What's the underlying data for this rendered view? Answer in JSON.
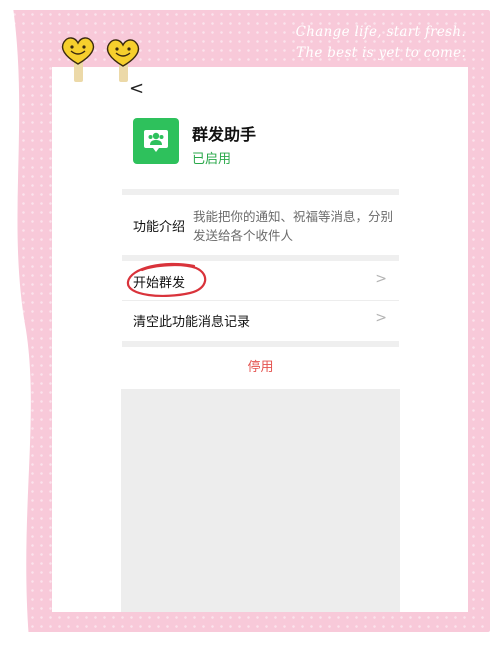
{
  "decor": {
    "tagline_line1": "Change life, start fresh.",
    "tagline_line2": "The best is yet to come.",
    "frame_color": "#f8c9d9",
    "accent_circle_color": "#d9333b"
  },
  "header": {
    "back_glyph": "<"
  },
  "app": {
    "name": "群发助手",
    "status": "已启用",
    "icon_color": "#2ec15c",
    "icon": "group-chat-icon"
  },
  "intro": {
    "label": "功能介绍",
    "text": "我能把你的通知、祝福等消息，分别发送给各个收件人"
  },
  "menu": {
    "items": [
      {
        "label": "开始群发",
        "chevron": ">"
      },
      {
        "label": "清空此功能消息记录",
        "chevron": ">"
      }
    ]
  },
  "actions": {
    "disable_label": "停用",
    "disable_color": "#e4534f"
  }
}
